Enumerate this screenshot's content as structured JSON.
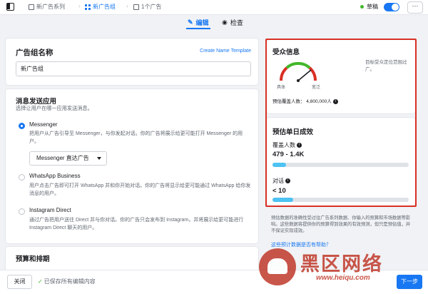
{
  "topbar": {
    "crumbs": [
      "新广告系列",
      "新广告组",
      "1个广告"
    ],
    "status": "草稿",
    "more": "···"
  },
  "tabs": {
    "edit": "编辑",
    "review": "检查"
  },
  "adset_name": {
    "title": "广告组名称",
    "link": "Create Name Template",
    "value": "新广告组"
  },
  "messaging": {
    "title": "消息发送应用",
    "subtitle": "选择让用户在哪一应用发送消息。",
    "options": [
      {
        "title": "Messenger",
        "desc": "把用户从广告引导至 Messenger，与你发起对话。你的广告将展示给更可能打开 Messenger 的用户。",
        "selected": true
      },
      {
        "title": "WhatsApp Business",
        "desc": "用户点击广告即可打开 WhatsApp 并和你开始对话。你的广告将显示给更可能通过 WhatsApp 给你发消息的用户。",
        "selected": false
      },
      {
        "title": "Instagram Direct",
        "desc": "通过广告把用户送往 Direct 并与你对话。你的广告只会发布到 Instagram，并将展示给更可能进行 Instagram Direct 聊天的用户。",
        "selected": false
      }
    ],
    "dropdown": "Messenger 直达广告"
  },
  "budget": {
    "title": "预算和排期"
  },
  "audience": {
    "title": "受众信息",
    "gauge_left": "具体",
    "gauge_right": "宽泛",
    "note": "目标受众定位范围过广。",
    "size_label": "预估覆盖人数： 4,800,000人"
  },
  "estimate": {
    "title": "预估单日成效",
    "reach_label": "覆盖人数",
    "reach_value": "479 - 1.4K",
    "reach_fill": 0.1,
    "conv_label": "对话",
    "conv_value": "< 10",
    "conv_fill": 0.15,
    "disclaimer": "预估数据的准确性受过往广告系列数据、你输入的预算和市场数据等影响。这些数据将提供你的预算得到效果的有效预测，但只是预估值，并不保证实际成效。",
    "help_link": "这些预计数据是否有帮助？"
  },
  "footer": {
    "close": "关闭",
    "saved": "已保存所有编辑内容",
    "next": "下一步"
  },
  "watermark": {
    "text": "黑区网络",
    "url": "www.heiqu.com"
  },
  "colors": {
    "accent": "#1877f2",
    "highlight": "#d93025",
    "bar": "#4cc3f2"
  }
}
